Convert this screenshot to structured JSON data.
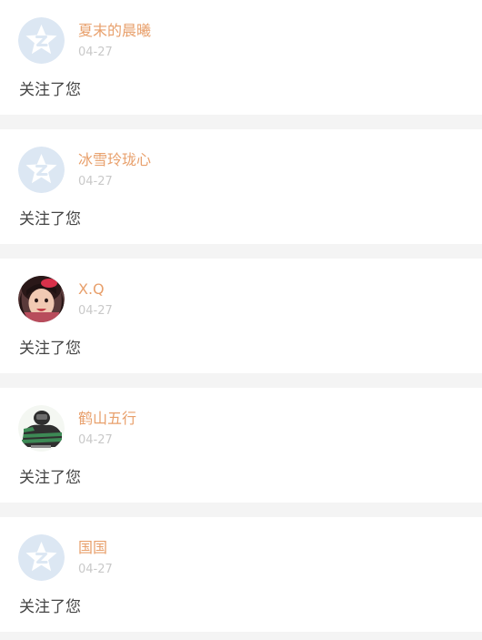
{
  "notifications": [
    {
      "name": "夏末的晨曦",
      "time": "04-27",
      "message": "关注了您",
      "avatar": "default-q-star-icon"
    },
    {
      "name": "冰雪玲珑心",
      "time": "04-27",
      "message": "关注了您",
      "avatar": "default-q-star-icon"
    },
    {
      "name": "X.Q",
      "time": "04-27",
      "message": "关注了您",
      "avatar": "child-photo-avatar"
    },
    {
      "name": "鹤山五行",
      "time": "04-27",
      "message": "关注了您",
      "avatar": "striped-photo-avatar"
    },
    {
      "name": "国国",
      "time": "04-27",
      "message": "关注了您",
      "avatar": "default-q-star-icon"
    }
  ],
  "colors": {
    "name": "#e8a06c",
    "time": "#c9c9c9",
    "message": "#444444",
    "separator": "#f4f4f4",
    "default_avatar_bg": "#dce7f3"
  }
}
